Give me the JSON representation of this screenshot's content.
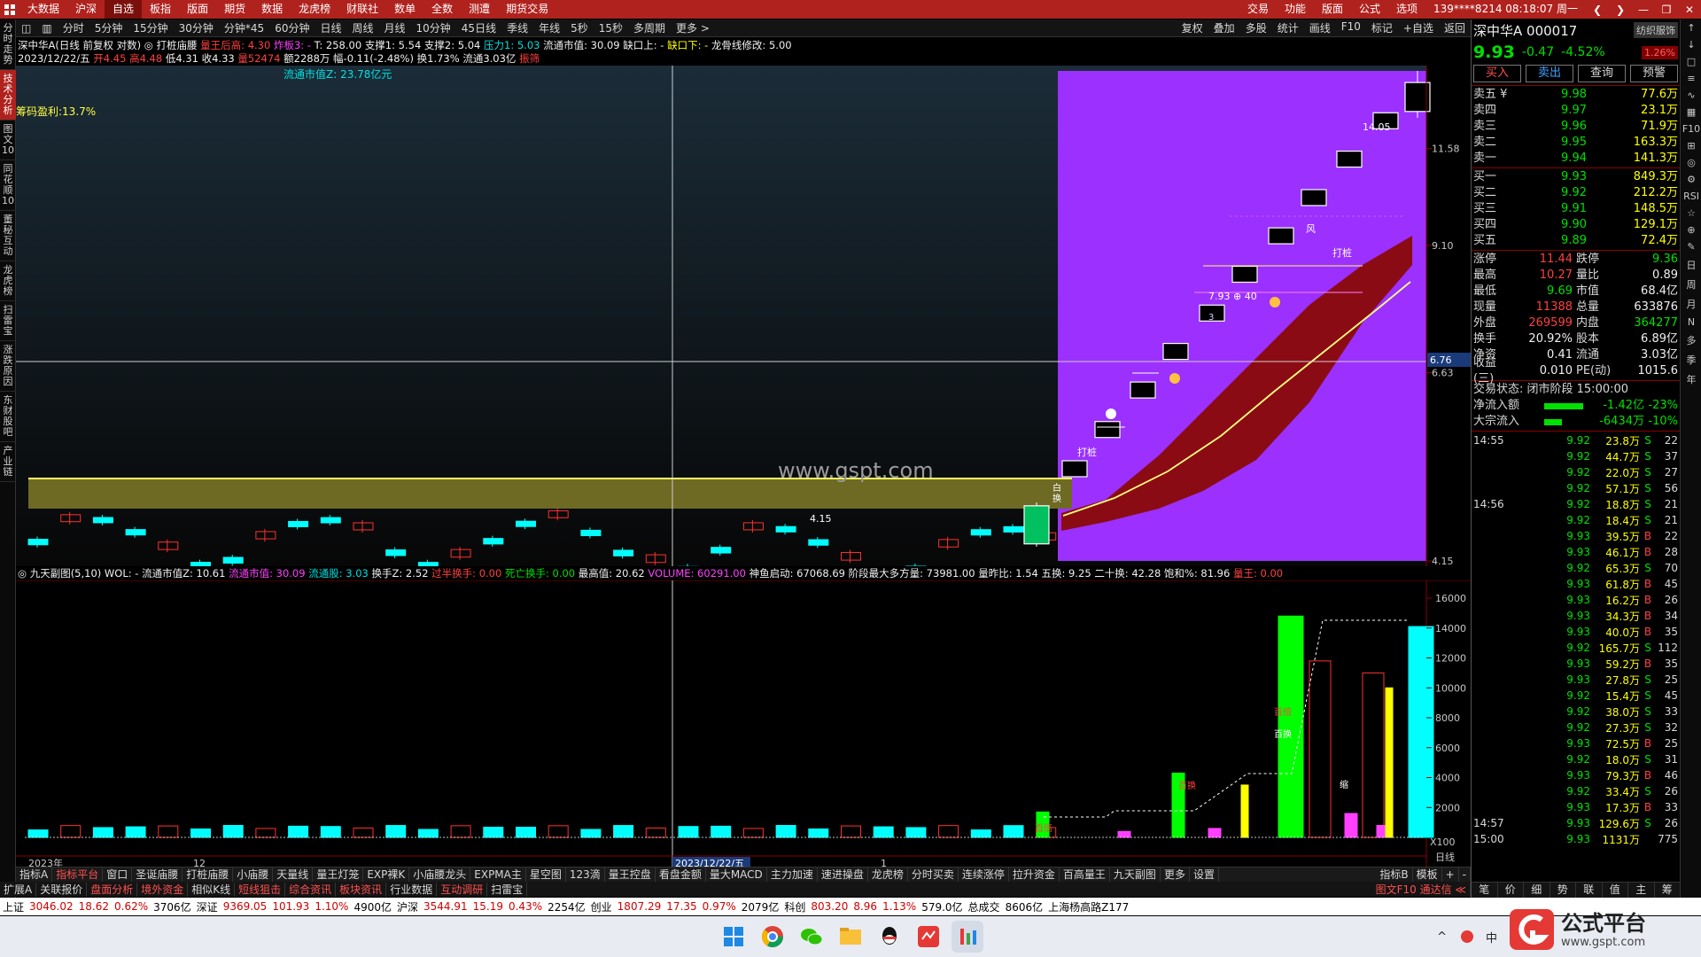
{
  "menubar": {
    "items": [
      "大数据",
      "沪深",
      "自选",
      "板指",
      "版面",
      "期货",
      "数据",
      "龙虎榜",
      "财联社",
      "数单",
      "全数",
      "测遭",
      "期货交易"
    ],
    "active_index": 2,
    "right_items": [
      "交易",
      "功能",
      "版面",
      "公式",
      "选项"
    ],
    "account": "139****8214 08:18:07 周一"
  },
  "periodbar": {
    "items": [
      "分时",
      "5分钟",
      "15分钟",
      "30分钟",
      "分钟*45",
      "60分钟",
      "日线",
      "周线",
      "月线",
      "10分钟",
      "45日线",
      "季线",
      "年线",
      "5秒",
      "15秒",
      "多周期",
      "更多 >"
    ],
    "tools": [
      "复权",
      "叠加",
      "多股",
      "统计",
      "画线",
      "F10",
      "标记",
      "+自选",
      "返回"
    ]
  },
  "lefttabs": [
    "分时走势",
    "技术分析",
    "图文10",
    "同花顺10",
    "董秘互动",
    "龙虎榜",
    "扫雷宝",
    "涨跌原因",
    "东财股吧",
    "产业链"
  ],
  "lefttab_active": 1,
  "info1": {
    "name": "深中华A(日线 前复权 对数)",
    "parts": [
      {
        "t": " ◎ 打桩庙腰 ",
        "c": "white"
      },
      {
        "t": "量王后高: 4.30 ",
        "c": "red"
      },
      {
        "t": "炸板3: - ",
        "c": "magenta"
      },
      {
        "t": "T: 258.00 ",
        "c": "white"
      },
      {
        "t": "支撑1: 5.54 ",
        "c": "white"
      },
      {
        "t": "支撑2: 5.04 ",
        "c": "white"
      },
      {
        "t": "压力1: 5.03 ",
        "c": "cyan"
      },
      {
        "t": "流通市值: 30.09 ",
        "c": "white"
      },
      {
        "t": "缺口上: - ",
        "c": "white"
      },
      {
        "t": "缺口下: - ",
        "c": "yellow"
      },
      {
        "t": "龙骨线修改: 5.00",
        "c": "white"
      }
    ]
  },
  "info2": {
    "parts": [
      {
        "t": "2023/12/22/五 ",
        "c": "white"
      },
      {
        "t": "开4.45 ",
        "c": "red"
      },
      {
        "t": "高4.48 ",
        "c": "red"
      },
      {
        "t": "低4.31 ",
        "c": "white"
      },
      {
        "t": "收4.33 ",
        "c": "white"
      },
      {
        "t": "量52474 ",
        "c": "red"
      },
      {
        "t": "额2288万 ",
        "c": "white"
      },
      {
        "t": "幅-0.11(-2.48%) ",
        "c": "white"
      },
      {
        "t": "换1.73% ",
        "c": "white"
      },
      {
        "t": "流通3.03亿 ",
        "c": "white"
      },
      {
        "t": "振筛",
        "c": "red"
      }
    ]
  },
  "chart_labels": {
    "flow_cap": "流通市值Z: 23.78亿元",
    "chip_profit": "筹码盈利:13.7%",
    "watermark": "www.gspt.com",
    "high_mark": "14.05",
    "low_mark": "4.15",
    "dazhuang": "打桩",
    "feng": "风",
    "dazhuang2": "打桩",
    "mid_mark": "7.93 ⊕ 40",
    "small3": "3",
    "bai": "白",
    "huan": "换"
  },
  "chart_data": {
    "type": "candlestick",
    "title": "深中华A(日线 前复权 对数)",
    "ylim": [
      4.15,
      14.05
    ],
    "y_ticks": [
      "11.58",
      "9.10",
      "6.63",
      "4.15"
    ],
    "cursor_price": "6.76",
    "candles_tail": [
      {
        "o": 4.33,
        "h": 4.8,
        "l": 4.3,
        "c": 4.76
      },
      {
        "o": 5.2,
        "h": 5.24,
        "l": 5.2,
        "c": 5.24
      },
      {
        "o": 5.74,
        "h": 5.77,
        "l": 5.74,
        "c": 5.77
      },
      {
        "o": 6.35,
        "h": 6.35,
        "l": 6.35,
        "c": 6.35
      },
      {
        "o": 6.99,
        "h": 6.99,
        "l": 6.99,
        "c": 6.99
      },
      {
        "o": 7.68,
        "h": 7.7,
        "l": 7.68,
        "c": 7.7
      },
      {
        "o": 8.47,
        "h": 8.47,
        "l": 8.47,
        "c": 8.47
      },
      {
        "o": 9.32,
        "h": 9.32,
        "l": 9.32,
        "c": 9.32
      },
      {
        "o": 10.25,
        "h": 10.25,
        "l": 10.25,
        "c": 10.25
      },
      {
        "o": 11.28,
        "h": 11.28,
        "l": 11.28,
        "c": 11.28
      },
      {
        "o": 12.41,
        "h": 12.41,
        "l": 12.41,
        "c": 12.41
      },
      {
        "o": 12.7,
        "h": 14.05,
        "l": 12.5,
        "c": 13.65
      }
    ]
  },
  "date_labels": {
    "year": "2023年",
    "month12": "12",
    "cursor_date": "2023/12/22/五",
    "month1": "1",
    "period": "日线"
  },
  "volinfo": {
    "parts": [
      {
        "t": "◎ 九天副图(5,10) WOL: - ",
        "c": "white"
      },
      {
        "t": "流通市值Z: 10.61 ",
        "c": "white"
      },
      {
        "t": "流通市值: 30.09 ",
        "c": "magenta"
      },
      {
        "t": "流通股: 3.03 ",
        "c": "cyan"
      },
      {
        "t": "换手Z: 2.52 ",
        "c": "white"
      },
      {
        "t": "过半换手: 0.00 ",
        "c": "red"
      },
      {
        "t": "死亡换手: 0.00 ",
        "c": "green"
      },
      {
        "t": "最高值: 20.62 ",
        "c": "white"
      },
      {
        "t": "VOLUME: 60291.00 ",
        "c": "magenta"
      },
      {
        "t": "神鱼启动: 67068.69 ",
        "c": "white"
      },
      {
        "t": "阶段最大多方量: 73981.00 ",
        "c": "white"
      },
      {
        "t": "量昨比: 1.54 ",
        "c": "white"
      },
      {
        "t": "五换: 9.25 ",
        "c": "white"
      },
      {
        "t": "二十换: 42.28 ",
        "c": "white"
      },
      {
        "t": "饱和%: 81.96 ",
        "c": "white"
      },
      {
        "t": "量王: 0.00",
        "c": "red"
      }
    ]
  },
  "vol_chart": {
    "ylim": [
      0,
      16000
    ],
    "y_ticks": [
      "16000",
      "14000",
      "12000",
      "10000",
      "8000",
      "6000",
      "4000",
      "2000"
    ],
    "unit": "X100",
    "labels": {
      "a": "百倍",
      "b": "百换",
      "c": "百倍",
      "d": "百换",
      "e": "缩"
    },
    "bars_tail": [
      1700,
      400,
      4300,
      600,
      3500,
      14800,
      11800,
      1600,
      11000,
      800,
      10000,
      14100
    ]
  },
  "bottomtabs": [
    "指标A",
    "指标平台",
    "窗口",
    "圣诞庙腰",
    "打桩庙腰",
    "小庙腰",
    "天量线",
    "量王灯笼",
    "EXP裸K",
    "小庙腰龙头",
    "EXPMA主",
    "星空图",
    "123滴",
    "量王控盘",
    "看盘金额",
    "量大MACD",
    "主力加速",
    "速进操盘",
    "龙虎榜",
    "分时买卖",
    "连续涨停",
    "拉升资金",
    "百高量王",
    "九天副图",
    "更多",
    "设置"
  ],
  "bottomtabs_right": [
    "指标B",
    "模板",
    "+",
    "-"
  ],
  "bottomtabs2": [
    "扩展A",
    "关联报价",
    "盘面分析",
    "境外资金",
    "相似K线",
    "短线狙击",
    "综合资讯",
    "板块资讯",
    "行业数据",
    "互动调研",
    "扫雷宝"
  ],
  "bottomtabs2_right": "图文F10 通达信 ≪",
  "statusbar": [
    {
      "t": "上证",
      "c": "k"
    },
    {
      "t": "3046.02",
      "c": "r"
    },
    {
      "t": "18.62",
      "c": "r"
    },
    {
      "t": "0.62%",
      "c": "r"
    },
    {
      "t": "3706亿",
      "c": "k"
    },
    {
      "t": "深证",
      "c": "k"
    },
    {
      "t": "9369.05",
      "c": "r"
    },
    {
      "t": "101.93",
      "c": "r"
    },
    {
      "t": "1.10%",
      "c": "r"
    },
    {
      "t": "4900亿",
      "c": "k"
    },
    {
      "t": "沪深",
      "c": "k"
    },
    {
      "t": "3544.91",
      "c": "r"
    },
    {
      "t": "15.19",
      "c": "r"
    },
    {
      "t": "0.43%",
      "c": "r"
    },
    {
      "t": "2254亿",
      "c": "k"
    },
    {
      "t": "创业",
      "c": "k"
    },
    {
      "t": "1807.29",
      "c": "r"
    },
    {
      "t": "17.35",
      "c": "r"
    },
    {
      "t": "0.97%",
      "c": "r"
    },
    {
      "t": "2079亿",
      "c": "k"
    },
    {
      "t": "科创",
      "c": "k"
    },
    {
      "t": "803.20",
      "c": "r"
    },
    {
      "t": "8.96",
      "c": "r"
    },
    {
      "t": "1.13%",
      "c": "r"
    },
    {
      "t": "579.0亿",
      "c": "k"
    },
    {
      "t": "总成交",
      "c": "k"
    },
    {
      "t": "8606亿",
      "c": "k"
    },
    {
      "t": "上海杨高路Z177",
      "c": "k"
    }
  ],
  "right": {
    "title": "深中华A 000017",
    "tag": "纺织服饰",
    "price": "9.93",
    "change": "-0.47",
    "pct": "-4.52%",
    "badge": "1.26%",
    "buttons": [
      "买入",
      "卖出",
      "查询",
      "预警"
    ],
    "asks": [
      {
        "l": "卖五 ¥",
        "p": "9.98",
        "v": "77.6万"
      },
      {
        "l": "卖四",
        "p": "9.97",
        "v": "23.1万"
      },
      {
        "l": "卖三",
        "p": "9.96",
        "v": "71.9万"
      },
      {
        "l": "卖二",
        "p": "9.95",
        "v": "163.3万"
      },
      {
        "l": "卖一",
        "p": "9.94",
        "v": "141.3万"
      }
    ],
    "bids": [
      {
        "l": "买一",
        "p": "9.93",
        "v": "849.3万"
      },
      {
        "l": "买二",
        "p": "9.92",
        "v": "212.2万"
      },
      {
        "l": "买三",
        "p": "9.91",
        "v": "148.5万"
      },
      {
        "l": "买四",
        "p": "9.90",
        "v": "129.1万"
      },
      {
        "l": "买五",
        "p": "9.89",
        "v": "72.4万"
      }
    ],
    "stats": [
      {
        "a": "涨停",
        "b": "11.44",
        "bc": "red",
        "c": "跌停",
        "d": "9.36",
        "dc": "green"
      },
      {
        "a": "最高",
        "b": "10.27",
        "bc": "red",
        "c": "量比",
        "d": "0.89",
        "dc": "white"
      },
      {
        "a": "最低",
        "b": "9.69",
        "bc": "green",
        "c": "市值",
        "d": "68.4亿",
        "dc": "white"
      },
      {
        "a": "现量",
        "b": "11388",
        "bc": "red",
        "c": "总量",
        "d": "633876",
        "dc": "white"
      },
      {
        "a": "外盘",
        "b": "269599",
        "bc": "red",
        "c": "内盘",
        "d": "364277",
        "dc": "green"
      },
      {
        "a": "换手",
        "b": "20.92%",
        "bc": "white",
        "c": "股本",
        "d": "6.89亿",
        "dc": "white"
      },
      {
        "a": "净资",
        "b": "0.41",
        "bc": "white",
        "c": "流通",
        "d": "3.03亿",
        "dc": "white"
      },
      {
        "a": "收益(三)",
        "b": "0.010",
        "bc": "white",
        "c": "PE(动)",
        "d": "1015.6",
        "dc": "white"
      }
    ],
    "trade_state": "交易状态: 闭市阶段 15:00:00",
    "netflow": {
      "l": "净流入额",
      "v": "-1.42亿",
      "p": "-23%"
    },
    "bigflow": {
      "l": "大宗流入",
      "v": "-6434万",
      "p": "-10%"
    },
    "ticks": [
      {
        "t": "14:55",
        "p": "9.92",
        "v": "23.8万",
        "s": "S",
        "n": "22"
      },
      {
        "t": "",
        "p": "9.92",
        "v": "44.7万",
        "s": "S",
        "n": "37"
      },
      {
        "t": "",
        "p": "9.92",
        "v": "22.0万",
        "s": "S",
        "n": "27"
      },
      {
        "t": "",
        "p": "9.92",
        "v": "57.1万",
        "s": "S",
        "n": "56"
      },
      {
        "t": "14:56",
        "p": "9.92",
        "v": "18.8万",
        "s": "S",
        "n": "21"
      },
      {
        "t": "",
        "p": "9.92",
        "v": "18.4万",
        "s": "S",
        "n": "21"
      },
      {
        "t": "",
        "p": "9.93",
        "v": "39.5万",
        "s": "B",
        "n": "22"
      },
      {
        "t": "",
        "p": "9.93",
        "v": "46.1万",
        "s": "B",
        "n": "28"
      },
      {
        "t": "",
        "p": "9.92",
        "v": "65.3万",
        "s": "S",
        "n": "70"
      },
      {
        "t": "",
        "p": "9.93",
        "v": "61.8万",
        "s": "B",
        "n": "45"
      },
      {
        "t": "",
        "p": "9.93",
        "v": "16.2万",
        "s": "B",
        "n": "26"
      },
      {
        "t": "",
        "p": "9.93",
        "v": "34.3万",
        "s": "B",
        "n": "34"
      },
      {
        "t": "",
        "p": "9.93",
        "v": "40.0万",
        "s": "B",
        "n": "35"
      },
      {
        "t": "",
        "p": "9.92",
        "v": "165.7万",
        "s": "S",
        "n": "112"
      },
      {
        "t": "",
        "p": "9.93",
        "v": "59.2万",
        "s": "B",
        "n": "35"
      },
      {
        "t": "",
        "p": "9.93",
        "v": "27.8万",
        "s": "S",
        "n": "25"
      },
      {
        "t": "",
        "p": "9.92",
        "v": "15.4万",
        "s": "S",
        "n": "45"
      },
      {
        "t": "",
        "p": "9.92",
        "v": "38.0万",
        "s": "S",
        "n": "33"
      },
      {
        "t": "",
        "p": "9.92",
        "v": "27.3万",
        "s": "S",
        "n": "32"
      },
      {
        "t": "",
        "p": "9.93",
        "v": "72.5万",
        "s": "B",
        "n": "25"
      },
      {
        "t": "",
        "p": "9.92",
        "v": "18.0万",
        "s": "S",
        "n": "31"
      },
      {
        "t": "",
        "p": "9.93",
        "v": "79.3万",
        "s": "B",
        "n": "46"
      },
      {
        "t": "",
        "p": "9.92",
        "v": "33.4万",
        "s": "S",
        "n": "26"
      },
      {
        "t": "",
        "p": "9.93",
        "v": "17.3万",
        "s": "B",
        "n": "33"
      },
      {
        "t": "14:57",
        "p": "9.93",
        "v": "129.6万",
        "s": "S",
        "n": "26"
      },
      {
        "t": "15:00",
        "p": "9.93",
        "v": "1131万",
        "s": "",
        "n": "775"
      }
    ],
    "bottom_tabs": [
      "笔",
      "价",
      "细",
      "势",
      "联",
      "值",
      "主",
      "筹"
    ]
  },
  "rstrip": [
    "↑",
    "↓",
    "□",
    "≡",
    "∿",
    "▦",
    "F10",
    "⊞",
    "◎",
    "⚙",
    "RSI",
    "☆",
    "⊕",
    "✎",
    "日",
    "周",
    "月",
    "N",
    "多",
    "季",
    "年"
  ],
  "taskbar": {
    "icons": [
      "windows-icon",
      "chrome-icon",
      "wechat-icon",
      "folder-icon",
      "qq-icon",
      "app-red-icon",
      "app-chart-icon"
    ]
  },
  "tray": {
    "caret": "^",
    "ime": "中"
  },
  "watermark_brand": {
    "name": "公式平台",
    "url": "www.gspt.com"
  },
  "colors": {
    "menubar": "#b0221e",
    "purple": "#9b30ff",
    "up": "#ff3030",
    "down": "#00ffff",
    "vol_green": "#00ff00",
    "yellow_line": "#ffff60"
  }
}
